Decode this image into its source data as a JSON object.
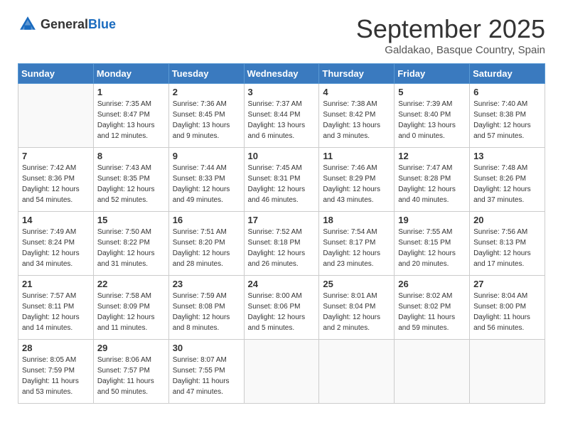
{
  "header": {
    "logo_general": "General",
    "logo_blue": "Blue",
    "month_title": "September 2025",
    "location": "Galdakao, Basque Country, Spain"
  },
  "days_of_week": [
    "Sunday",
    "Monday",
    "Tuesday",
    "Wednesday",
    "Thursday",
    "Friday",
    "Saturday"
  ],
  "weeks": [
    [
      {
        "day": "",
        "sunrise": "",
        "sunset": "",
        "daylight": ""
      },
      {
        "day": "1",
        "sunrise": "Sunrise: 7:35 AM",
        "sunset": "Sunset: 8:47 PM",
        "daylight": "Daylight: 13 hours and 12 minutes."
      },
      {
        "day": "2",
        "sunrise": "Sunrise: 7:36 AM",
        "sunset": "Sunset: 8:45 PM",
        "daylight": "Daylight: 13 hours and 9 minutes."
      },
      {
        "day": "3",
        "sunrise": "Sunrise: 7:37 AM",
        "sunset": "Sunset: 8:44 PM",
        "daylight": "Daylight: 13 hours and 6 minutes."
      },
      {
        "day": "4",
        "sunrise": "Sunrise: 7:38 AM",
        "sunset": "Sunset: 8:42 PM",
        "daylight": "Daylight: 13 hours and 3 minutes."
      },
      {
        "day": "5",
        "sunrise": "Sunrise: 7:39 AM",
        "sunset": "Sunset: 8:40 PM",
        "daylight": "Daylight: 13 hours and 0 minutes."
      },
      {
        "day": "6",
        "sunrise": "Sunrise: 7:40 AM",
        "sunset": "Sunset: 8:38 PM",
        "daylight": "Daylight: 12 hours and 57 minutes."
      }
    ],
    [
      {
        "day": "7",
        "sunrise": "Sunrise: 7:42 AM",
        "sunset": "Sunset: 8:36 PM",
        "daylight": "Daylight: 12 hours and 54 minutes."
      },
      {
        "day": "8",
        "sunrise": "Sunrise: 7:43 AM",
        "sunset": "Sunset: 8:35 PM",
        "daylight": "Daylight: 12 hours and 52 minutes."
      },
      {
        "day": "9",
        "sunrise": "Sunrise: 7:44 AM",
        "sunset": "Sunset: 8:33 PM",
        "daylight": "Daylight: 12 hours and 49 minutes."
      },
      {
        "day": "10",
        "sunrise": "Sunrise: 7:45 AM",
        "sunset": "Sunset: 8:31 PM",
        "daylight": "Daylight: 12 hours and 46 minutes."
      },
      {
        "day": "11",
        "sunrise": "Sunrise: 7:46 AM",
        "sunset": "Sunset: 8:29 PM",
        "daylight": "Daylight: 12 hours and 43 minutes."
      },
      {
        "day": "12",
        "sunrise": "Sunrise: 7:47 AM",
        "sunset": "Sunset: 8:28 PM",
        "daylight": "Daylight: 12 hours and 40 minutes."
      },
      {
        "day": "13",
        "sunrise": "Sunrise: 7:48 AM",
        "sunset": "Sunset: 8:26 PM",
        "daylight": "Daylight: 12 hours and 37 minutes."
      }
    ],
    [
      {
        "day": "14",
        "sunrise": "Sunrise: 7:49 AM",
        "sunset": "Sunset: 8:24 PM",
        "daylight": "Daylight: 12 hours and 34 minutes."
      },
      {
        "day": "15",
        "sunrise": "Sunrise: 7:50 AM",
        "sunset": "Sunset: 8:22 PM",
        "daylight": "Daylight: 12 hours and 31 minutes."
      },
      {
        "day": "16",
        "sunrise": "Sunrise: 7:51 AM",
        "sunset": "Sunset: 8:20 PM",
        "daylight": "Daylight: 12 hours and 28 minutes."
      },
      {
        "day": "17",
        "sunrise": "Sunrise: 7:52 AM",
        "sunset": "Sunset: 8:18 PM",
        "daylight": "Daylight: 12 hours and 26 minutes."
      },
      {
        "day": "18",
        "sunrise": "Sunrise: 7:54 AM",
        "sunset": "Sunset: 8:17 PM",
        "daylight": "Daylight: 12 hours and 23 minutes."
      },
      {
        "day": "19",
        "sunrise": "Sunrise: 7:55 AM",
        "sunset": "Sunset: 8:15 PM",
        "daylight": "Daylight: 12 hours and 20 minutes."
      },
      {
        "day": "20",
        "sunrise": "Sunrise: 7:56 AM",
        "sunset": "Sunset: 8:13 PM",
        "daylight": "Daylight: 12 hours and 17 minutes."
      }
    ],
    [
      {
        "day": "21",
        "sunrise": "Sunrise: 7:57 AM",
        "sunset": "Sunset: 8:11 PM",
        "daylight": "Daylight: 12 hours and 14 minutes."
      },
      {
        "day": "22",
        "sunrise": "Sunrise: 7:58 AM",
        "sunset": "Sunset: 8:09 PM",
        "daylight": "Daylight: 12 hours and 11 minutes."
      },
      {
        "day": "23",
        "sunrise": "Sunrise: 7:59 AM",
        "sunset": "Sunset: 8:08 PM",
        "daylight": "Daylight: 12 hours and 8 minutes."
      },
      {
        "day": "24",
        "sunrise": "Sunrise: 8:00 AM",
        "sunset": "Sunset: 8:06 PM",
        "daylight": "Daylight: 12 hours and 5 minutes."
      },
      {
        "day": "25",
        "sunrise": "Sunrise: 8:01 AM",
        "sunset": "Sunset: 8:04 PM",
        "daylight": "Daylight: 12 hours and 2 minutes."
      },
      {
        "day": "26",
        "sunrise": "Sunrise: 8:02 AM",
        "sunset": "Sunset: 8:02 PM",
        "daylight": "Daylight: 11 hours and 59 minutes."
      },
      {
        "day": "27",
        "sunrise": "Sunrise: 8:04 AM",
        "sunset": "Sunset: 8:00 PM",
        "daylight": "Daylight: 11 hours and 56 minutes."
      }
    ],
    [
      {
        "day": "28",
        "sunrise": "Sunrise: 8:05 AM",
        "sunset": "Sunset: 7:59 PM",
        "daylight": "Daylight: 11 hours and 53 minutes."
      },
      {
        "day": "29",
        "sunrise": "Sunrise: 8:06 AM",
        "sunset": "Sunset: 7:57 PM",
        "daylight": "Daylight: 11 hours and 50 minutes."
      },
      {
        "day": "30",
        "sunrise": "Sunrise: 8:07 AM",
        "sunset": "Sunset: 7:55 PM",
        "daylight": "Daylight: 11 hours and 47 minutes."
      },
      {
        "day": "",
        "sunrise": "",
        "sunset": "",
        "daylight": ""
      },
      {
        "day": "",
        "sunrise": "",
        "sunset": "",
        "daylight": ""
      },
      {
        "day": "",
        "sunrise": "",
        "sunset": "",
        "daylight": ""
      },
      {
        "day": "",
        "sunrise": "",
        "sunset": "",
        "daylight": ""
      }
    ]
  ]
}
